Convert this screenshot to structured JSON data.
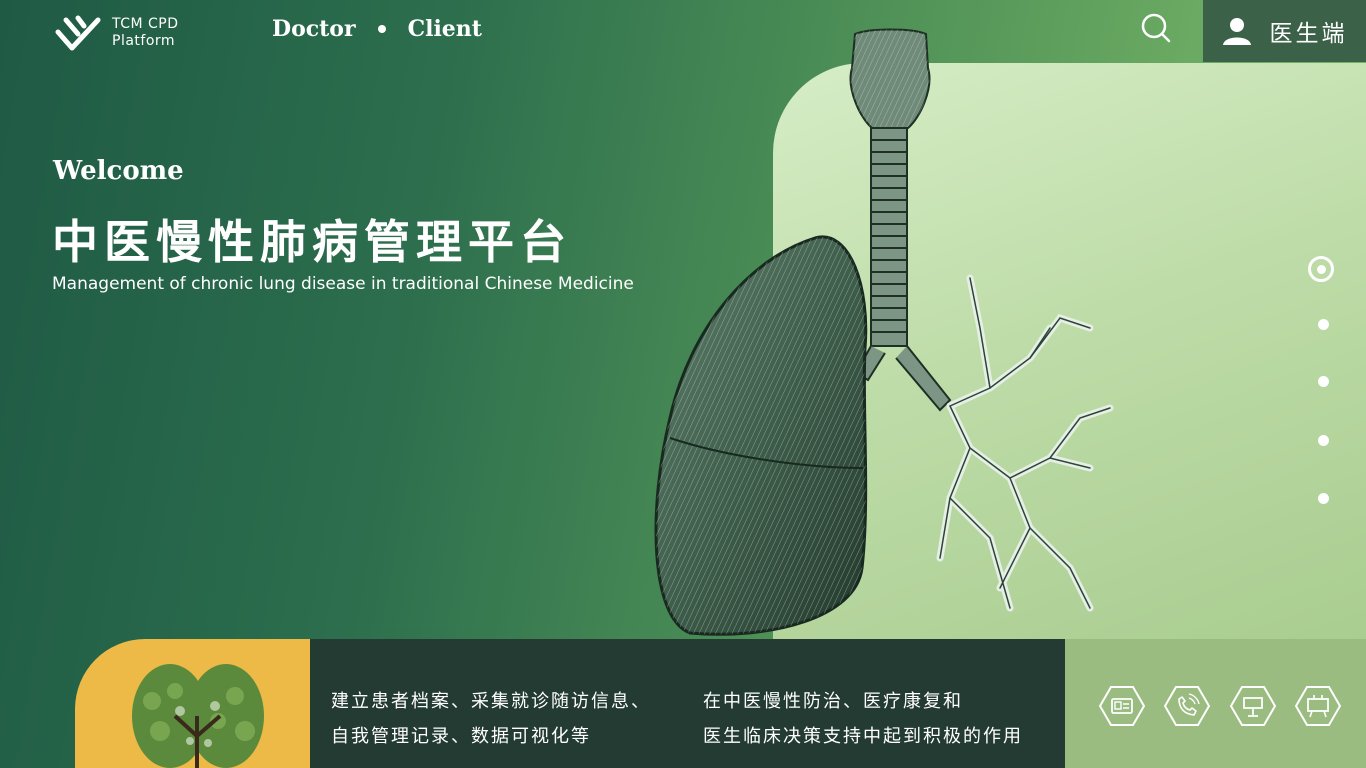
{
  "brand": {
    "line1": "TCM CPD",
    "line2": "Platform"
  },
  "nav": {
    "doctor_label": "Doctor",
    "client_label": "Client"
  },
  "header": {
    "user_label": "医生端",
    "search_icon": "search-icon",
    "user_icon": "user-icon"
  },
  "hero": {
    "welcome": "Welcome",
    "title": "中医慢性肺病管理平台",
    "subtitle": "Management of chronic lung disease in traditional Chinese Medicine"
  },
  "pager": {
    "count": 5,
    "active_index": 0
  },
  "bottom": {
    "col1_line1": "建立患者档案、采集就诊随访信息、",
    "col1_line2": "自我管理记录、数据可视化等",
    "col2_line1": "在中医慢性防治、医疗康复和",
    "col2_line2": "医生临床决策支持中起到积极的作用",
    "icons": [
      "id-card-icon",
      "phone-call-icon",
      "signboard-icon",
      "monitor-icon"
    ]
  },
  "colors": {
    "accent_yellow": "#edba48",
    "dark_panel": "#233b33",
    "light_panel": "#9bbc80",
    "header_user_bg": "#3b6248"
  }
}
